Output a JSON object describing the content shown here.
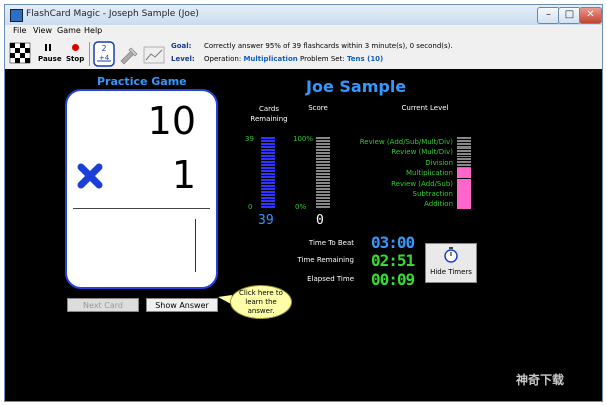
{
  "window": {
    "title": "FlashCard Magic - Joseph  Sample (Joe)"
  },
  "menu": [
    "File",
    "View",
    "Game",
    "Help"
  ],
  "toolbar": {
    "pause_label": "Pause",
    "stop_label": "Stop"
  },
  "goal": {
    "goal_label": "Goal:",
    "goal_text": "Correctly answer 95% of 39 flashcards within 3 minute(s), 0 second(s).",
    "level_label": "Level:",
    "operation_label": "Operation:",
    "operation_value": "Multiplication",
    "problem_set_label": "Problem Set:",
    "problem_set_value": "Tens (10)"
  },
  "game": {
    "title": "Practice Game",
    "player_name": "Joe Sample",
    "card": {
      "top_number": "10",
      "bottom_number": "1",
      "operator": "multiply"
    },
    "next_card_label": "Next Card",
    "show_answer_label": "Show Answer",
    "hint_text": "Click here to learn the answer."
  },
  "progress": {
    "cards_remaining_header": "Cards Remaining",
    "score_header": "Score",
    "current_level_header": "Current Level",
    "cards_max_label": "39",
    "cards_min_label": "0",
    "cards_remaining_value": "39",
    "cards_remaining_fraction": 1.0,
    "score_max_label": "100%",
    "score_min_label": "0%",
    "score_value": "0",
    "score_fraction": 0.0,
    "levels": [
      {
        "name": "Review (Add/Sub/Mult/Div)",
        "active": false
      },
      {
        "name": "Review (Mult/Div)",
        "active": false
      },
      {
        "name": "Division",
        "active": false
      },
      {
        "name": "Multiplication",
        "active": true
      },
      {
        "name": "Review (Add/Sub)",
        "active": true
      },
      {
        "name": "Subtraction",
        "active": true
      },
      {
        "name": "Addition",
        "active": true
      }
    ]
  },
  "timers": {
    "time_to_beat_label": "Time To Beat",
    "time_to_beat_value": "03:00",
    "time_remaining_label": "Time Remaining",
    "time_remaining_value": "02:51",
    "elapsed_time_label": "Elapsed Time",
    "elapsed_time_value": "00:09",
    "hide_timers_label": "Hide Timers"
  },
  "colors": {
    "title_blue": "#3399ff",
    "level_green": "#33cc33",
    "active_pink": "#ff66cc",
    "timer_green": "#33dd33"
  },
  "watermark": {
    "text": "神奇下载"
  }
}
